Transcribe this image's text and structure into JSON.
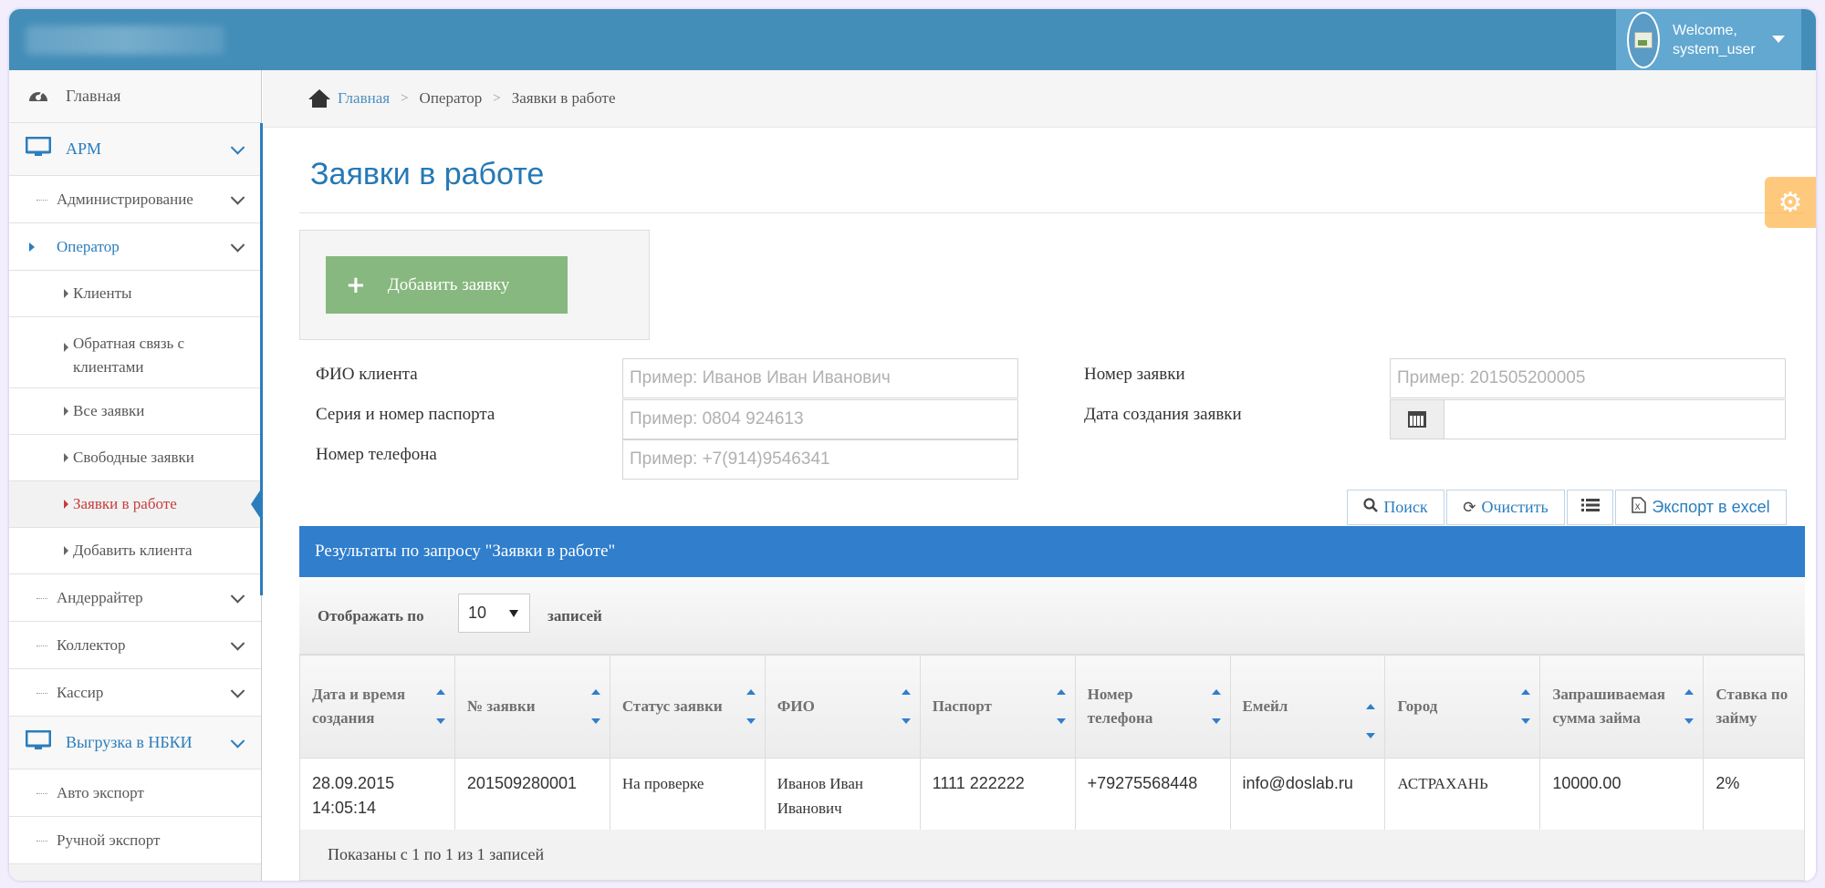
{
  "header": {
    "welcome_line1": "Welcome,",
    "welcome_line2": "system_user",
    "brand_color": "#438eb9",
    "user_menu_color": "#62a8d1"
  },
  "sidebar": {
    "home": "Главная",
    "arm": "АРМ",
    "admin": "Администрирование",
    "operator": "Оператор",
    "clients": "Клиенты",
    "feedback": "Обратная связь с клиентами",
    "all_requests": "Все заявки",
    "free_requests": "Свободные заявки",
    "requests_in_work": "Заявки в работе",
    "add_client": "Добавить клиента",
    "underwriter": "Андеррайтер",
    "collector": "Коллектор",
    "cashier": "Кассир",
    "nbki_upload": "Выгрузка в НБКИ",
    "auto_export": "Авто экспорт",
    "manual_export": "Ручной экспорт"
  },
  "breadcrumb": {
    "home": "Главная",
    "operator": "Оператор",
    "current": "Заявки в работе"
  },
  "page": {
    "title": "Заявки в работе",
    "add_button": "Добавить заявку"
  },
  "filters": {
    "fio_label": "ФИО клиента",
    "fio_placeholder": "Пример: Иванов Иван Иванович",
    "passport_label": "Серия и номер паспорта",
    "passport_placeholder": "Пример: 0804 924613",
    "phone_label": "Номер телефона",
    "phone_placeholder": "Пример: +7(914)9546341",
    "request_no_label": "Номер заявки",
    "request_no_placeholder": "Пример: 201505200005",
    "created_label": "Дата создания заявки",
    "created_value": ""
  },
  "toolbar": {
    "search": "Поиск",
    "clear": "Очистить",
    "export": "Экспорт в excel"
  },
  "results": {
    "heading": "Результаты по запросу \"Заявки в работе\"",
    "length_prefix": "Отображать по",
    "length_value": "10",
    "length_suffix": "записей",
    "columns": [
      "Дата и время создания",
      "№ заявки",
      "Статус заявки",
      "ФИО",
      "Паспорт",
      "Номер телефона",
      "Емейл",
      "Город",
      "Запрашиваемая сумма займа",
      "Ставка по займу"
    ],
    "rows": [
      {
        "date": "28.09.2015 14:05:14",
        "number": "201509280001",
        "status": "На проверке",
        "fio": "Иванов Иван Иванович",
        "passport": "1111 222222",
        "phone": "+79275568448",
        "email": "info@doslab.ru",
        "city": "АСТРАХАНЬ",
        "amount": "10000.00",
        "rate": "2%"
      }
    ],
    "info": "Показаны с 1 по 1 из 1 записей"
  }
}
